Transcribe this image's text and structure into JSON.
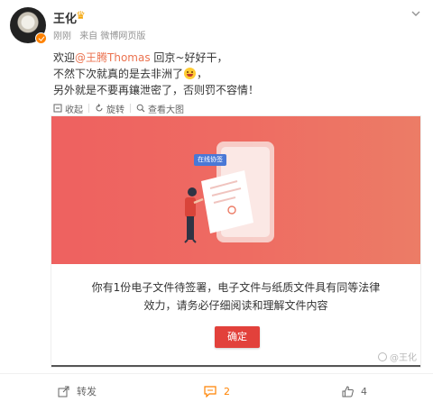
{
  "post": {
    "author": "王化",
    "author_badge_icon": "crown-icon",
    "time": "刚刚",
    "source": "来自 微博网页版",
    "text_line1_prefix": "欢迎",
    "mention": "@王腾Thomas",
    "text_line1_suffix": " 回京~好好干，",
    "text_line2": "不然下次就真的是去非洲了",
    "text_line2_end": "，",
    "text_line3": "另外就是不要再鑲泄密了，否则罚不容情！"
  },
  "toolbar": {
    "collapse": "收起",
    "rotate": "旋转",
    "view_large": "查看大图"
  },
  "media": {
    "illustration_tag": "在线协签",
    "message_line1": "你有1份电子文件待签署，电子文件与纸质文件具有同等法律",
    "message_line2": "效力，请务必仔细阅读和理解文件内容",
    "confirm_label": "确定",
    "watermark": "@王化"
  },
  "actions": {
    "repost_label": "转发",
    "comment_count": "2",
    "like_count": "4"
  },
  "colors": {
    "accent": "#ff8200",
    "mention": "#eb7350",
    "banner": "#ee6561",
    "confirm": "#e2413b"
  }
}
